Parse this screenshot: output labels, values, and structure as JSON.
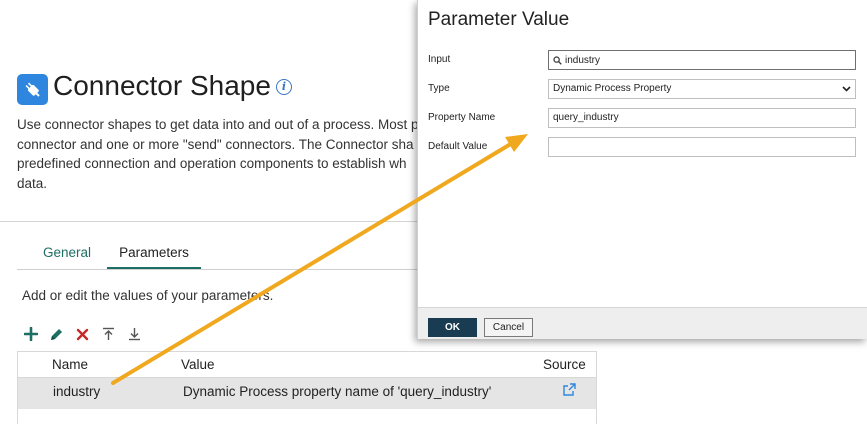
{
  "page": {
    "title": "Connector Shape",
    "icon": "plug-icon",
    "description_lines": [
      "Use connector shapes to get data into and out of a process. Most p",
      "connector and one or more \"send\" connectors. The Connector sha",
      "predefined connection and operation components to establish wh",
      "data."
    ]
  },
  "tabs": [
    {
      "label": "General",
      "active": false
    },
    {
      "label": "Parameters",
      "active": true
    }
  ],
  "parameters": {
    "hint": "Add or edit the values of your parameters.",
    "toolbar": {
      "add": "plus-icon",
      "edit": "pencil-icon",
      "delete": "x-icon",
      "move_top": "move-top-icon",
      "move_bottom": "move-bottom-icon"
    },
    "columns": {
      "name": "Name",
      "value": "Value",
      "source": "Source"
    },
    "rows": [
      {
        "name": "industry",
        "value": "Dynamic Process property name of 'query_industry'",
        "source_icon": "external-link-icon"
      }
    ]
  },
  "dialog": {
    "title": "Parameter Value",
    "fields": {
      "input": {
        "label": "Input",
        "value": "industry"
      },
      "type": {
        "label": "Type",
        "value": "Dynamic Process Property"
      },
      "property_name": {
        "label": "Property Name",
        "value": "query_industry"
      },
      "default_value": {
        "label": "Default Value",
        "value": ""
      }
    },
    "ok_label": "OK",
    "cancel_label": "Cancel"
  },
  "colors": {
    "accent_teal": "#1d6f64",
    "icon_blue": "#2e86de",
    "ok_button": "#1a3c52",
    "arrow": "#f0a81e",
    "delete_red": "#c62828"
  }
}
